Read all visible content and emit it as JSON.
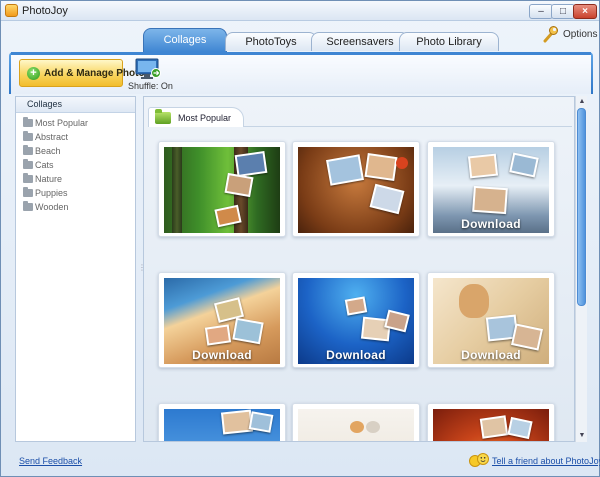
{
  "window": {
    "title": "PhotoJoy"
  },
  "tabs": [
    {
      "label": "Collages",
      "active": true
    },
    {
      "label": "PhotoToys",
      "active": false
    },
    {
      "label": "Screensavers",
      "active": false
    },
    {
      "label": "Photo Library",
      "active": false
    }
  ],
  "options": {
    "label": "Options",
    "icon": "wrench-icon"
  },
  "toolbar": {
    "add_manage_label": "Add & Manage Photos",
    "add_icon": "plus-icon",
    "shuffle_label": "Shuffle: On",
    "shuffle_icon": "monitor-shuffle-icon"
  },
  "sidebar": {
    "header": "Collages",
    "items": [
      {
        "label": "Most Popular"
      },
      {
        "label": "Abstract"
      },
      {
        "label": "Beach"
      },
      {
        "label": "Cats"
      },
      {
        "label": "Nature"
      },
      {
        "label": "Puppies"
      },
      {
        "label": "Wooden"
      }
    ]
  },
  "content": {
    "section_title": "Most Popular",
    "section_icon": "green-folder-icon",
    "thumbnails": [
      {
        "overlay": ""
      },
      {
        "overlay": ""
      },
      {
        "overlay": "Download"
      },
      {
        "overlay": "Download"
      },
      {
        "overlay": "Download"
      },
      {
        "overlay": "Download"
      },
      {
        "overlay": ""
      },
      {
        "overlay": ""
      },
      {
        "overlay": ""
      }
    ]
  },
  "footer": {
    "feedback_label": "Send Feedback",
    "tell_friend_label": "Tell a friend about PhotoJoy",
    "tell_icon": "smiley-faces-icon"
  },
  "colors": {
    "accent_blue": "#3f86d3",
    "button_yellow": "#f8d35a",
    "link_blue": "#1b4fa8"
  }
}
